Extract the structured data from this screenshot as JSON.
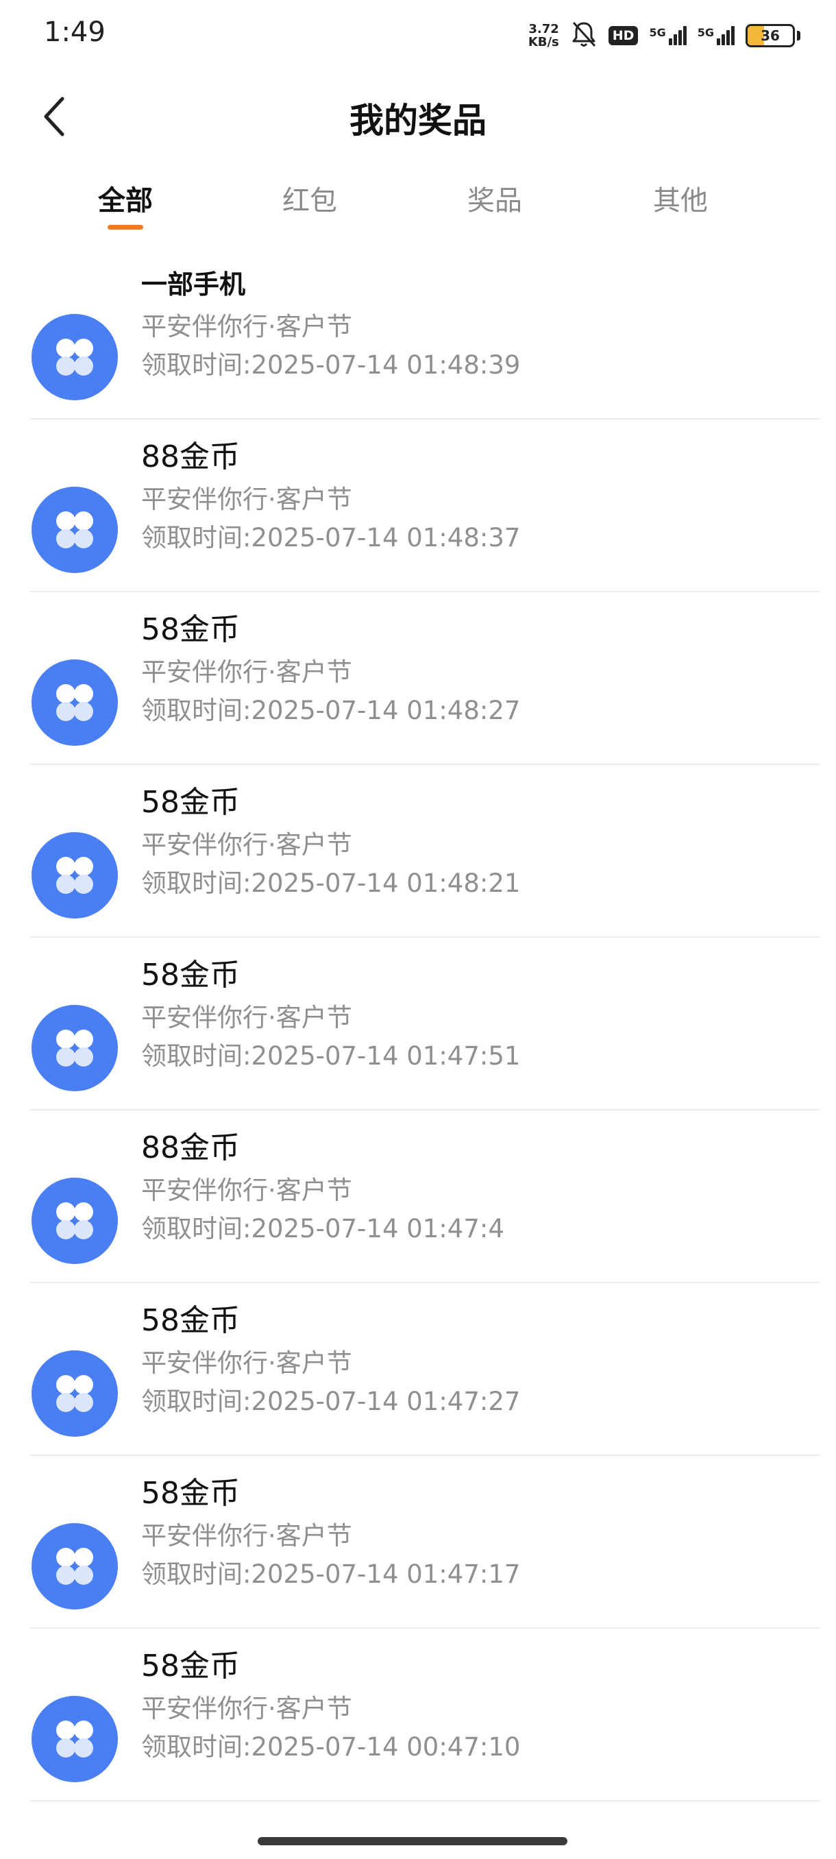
{
  "status_bar": {
    "time": "1:49",
    "net_speed_value": "3.72",
    "net_speed_unit": "KB/s",
    "hd_label": "HD",
    "sim1_label": "5G",
    "sim2_label": "5G",
    "battery_level": "36",
    "battery_fraction": 0.36
  },
  "header": {
    "title": "我的奖品"
  },
  "tabs": [
    {
      "label": "全部",
      "active": true
    },
    {
      "label": "红包",
      "active": false
    },
    {
      "label": "奖品",
      "active": false
    },
    {
      "label": "其他",
      "active": false
    }
  ],
  "prizes": [
    {
      "name": "一部手机",
      "source": "平安伴你行·客户节",
      "time": "领取时间:2025-07-14 01:48:39"
    },
    {
      "name": "88金币",
      "source": "平安伴你行·客户节",
      "time": "领取时间:2025-07-14 01:48:37"
    },
    {
      "name": "58金币",
      "source": "平安伴你行·客户节",
      "time": "领取时间:2025-07-14 01:48:27"
    },
    {
      "name": "58金币",
      "source": "平安伴你行·客户节",
      "time": "领取时间:2025-07-14 01:48:21"
    },
    {
      "name": "58金币",
      "source": "平安伴你行·客户节",
      "time": "领取时间:2025-07-14 01:47:51"
    },
    {
      "name": "88金币",
      "source": "平安伴你行·客户节",
      "time": "领取时间:2025-07-14 01:47:4"
    },
    {
      "name": "58金币",
      "source": "平安伴你行·客户节",
      "time": "领取时间:2025-07-14 01:47:27"
    },
    {
      "name": "58金币",
      "source": "平安伴你行·客户节",
      "time": "领取时间:2025-07-14 01:47:17"
    },
    {
      "name": "58金币",
      "source": "平安伴你行·客户节",
      "time": "领取时间:2025-07-14 00:47:10"
    }
  ],
  "icons": {
    "back": "chevron-left-icon",
    "prize": "four-petal-icon",
    "mute": "bell-muted-icon"
  },
  "colors": {
    "accent": "#f47a22",
    "icon_blue": "#4a7ef3",
    "secondary_text": "#8f8f8f"
  }
}
